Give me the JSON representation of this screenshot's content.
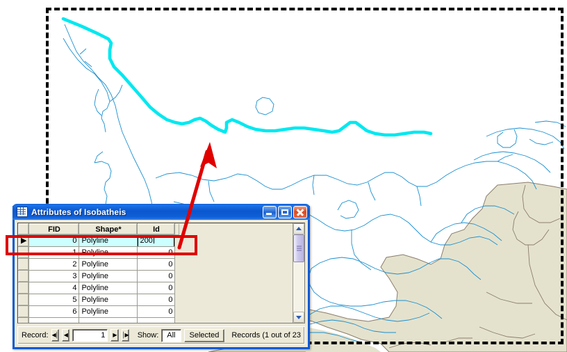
{
  "window": {
    "title": "Attributes of Isobatheis",
    "icon": "table-icon",
    "buttons": {
      "minimize": "minimize-icon",
      "maximize": "maximize-icon",
      "close": "close-icon"
    }
  },
  "table": {
    "columns": [
      "",
      "FID",
      "Shape*",
      "Id"
    ],
    "selected_column": "Id",
    "rows": [
      {
        "marker": "▶",
        "fid": "0",
        "shape": "Polyline",
        "id": "200",
        "selected": true,
        "editing": true
      },
      {
        "marker": "",
        "fid": "1",
        "shape": "Polyline",
        "id": "0",
        "selected": false,
        "editing": false
      },
      {
        "marker": "",
        "fid": "2",
        "shape": "Polyline",
        "id": "0",
        "selected": false,
        "editing": false
      },
      {
        "marker": "",
        "fid": "3",
        "shape": "Polyline",
        "id": "0",
        "selected": false,
        "editing": false
      },
      {
        "marker": "",
        "fid": "4",
        "shape": "Polyline",
        "id": "0",
        "selected": false,
        "editing": false
      },
      {
        "marker": "",
        "fid": "5",
        "shape": "Polyline",
        "id": "0",
        "selected": false,
        "editing": false
      },
      {
        "marker": "",
        "fid": "6",
        "shape": "Polyline",
        "id": "0",
        "selected": false,
        "editing": false
      }
    ]
  },
  "status_bar": {
    "record_label": "Record:",
    "first_glyph": "◀│",
    "prev_glyph": "◀",
    "next_glyph": "▶",
    "last_glyph": "│▶",
    "record_value": "1",
    "show_label": "Show:",
    "show_all": "All",
    "show_selected": "Selected",
    "records_count": "Records  (1 out of 23"
  },
  "map": {
    "selection_frame": "dashed-selection-frame",
    "highlight_color": "#00e8f0",
    "contour_color": "#1a8fd0",
    "land_color": "#e4e2cd",
    "land_border_color": "#8b7d6b",
    "annotation_color": "#e00000"
  }
}
